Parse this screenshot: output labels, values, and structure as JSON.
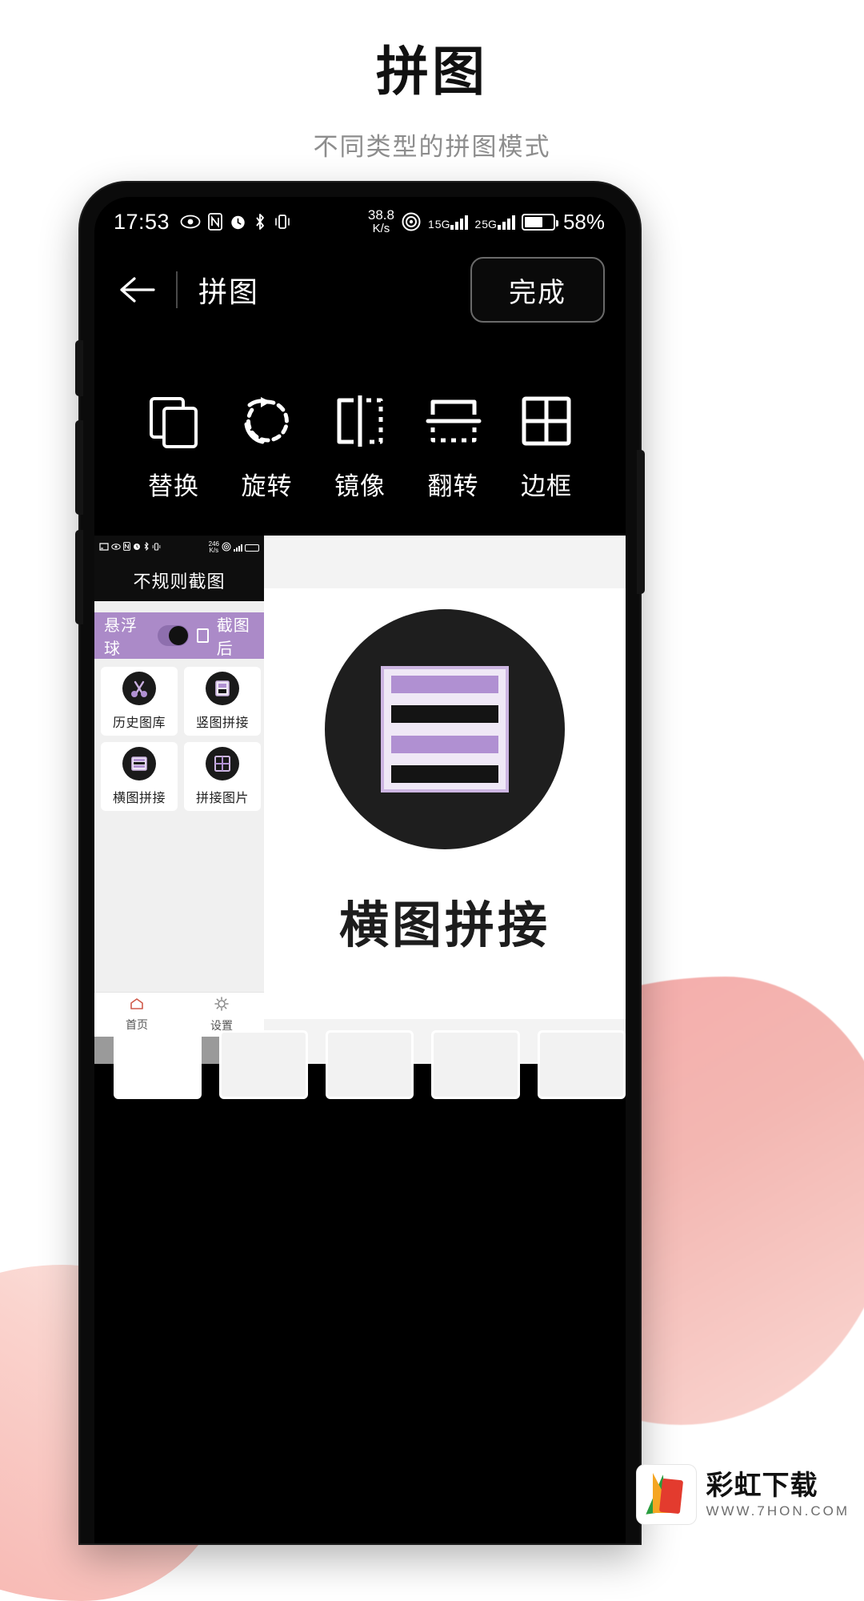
{
  "header": {
    "title": "拼图",
    "subtitle": "不同类型的拼图模式"
  },
  "phone": {
    "status_bar": {
      "time": "17:53",
      "icons": [
        "eye-icon",
        "nfc-icon",
        "alarm-icon",
        "bluetooth-icon",
        "vibrate-icon"
      ],
      "net_speed_value": "38.8",
      "net_speed_unit": "K/s",
      "location_icon": "location-icon",
      "sim1_label": "1",
      "sim1_network": "5G",
      "sim2_label": "2",
      "sim2_network": "5G",
      "battery_percent": "58%",
      "battery_icon": "battery-muted-icon"
    },
    "app_bar": {
      "back_icon": "back-arrow-icon",
      "title": "拼图",
      "done_label": "完成"
    },
    "tools": [
      {
        "icon": "replace-icon",
        "label": "替换"
      },
      {
        "icon": "rotate-icon",
        "label": "旋转"
      },
      {
        "icon": "mirror-icon",
        "label": "镜像"
      },
      {
        "icon": "flip-icon",
        "label": "翻转"
      },
      {
        "icon": "border-icon",
        "label": "边框"
      }
    ],
    "preview": {
      "left_shot": {
        "mini_status": {
          "cast_icon": "cast-icon",
          "icons": [
            "eye-icon",
            "nfc-icon",
            "alarm-icon",
            "bluetooth-icon",
            "vibrate-icon"
          ],
          "speed_value": "246",
          "speed_unit": "K/s"
        },
        "title": "不规则截图",
        "float_row": {
          "label": "悬浮球",
          "toggle_on": true,
          "checkbox_label": "截图后"
        },
        "cards": [
          {
            "icon": "gallery-icon",
            "label": "历史图库"
          },
          {
            "icon": "vertical-stitch-icon",
            "label": "竖图拼接"
          },
          {
            "icon": "horizontal-stitch-icon",
            "label": "横图拼接"
          },
          {
            "icon": "grid-stitch-icon",
            "label": "拼接图片"
          }
        ],
        "bottom_nav": [
          {
            "icon": "home-icon",
            "label": "首页"
          },
          {
            "icon": "gear-icon",
            "label": "设置"
          }
        ]
      },
      "right_shot": {
        "logo_icon": "horizontal-stitch-logo",
        "caption": "横图拼接"
      }
    }
  },
  "watermark": {
    "title": "彩虹下载",
    "sub": "WWW.7HON.COM"
  },
  "colors": {
    "accent_purple": "#ab8ac8",
    "logo_purple": "#b090d2",
    "blob_pink": "#f6a9a9",
    "phone_black": "#0b0b0b"
  }
}
